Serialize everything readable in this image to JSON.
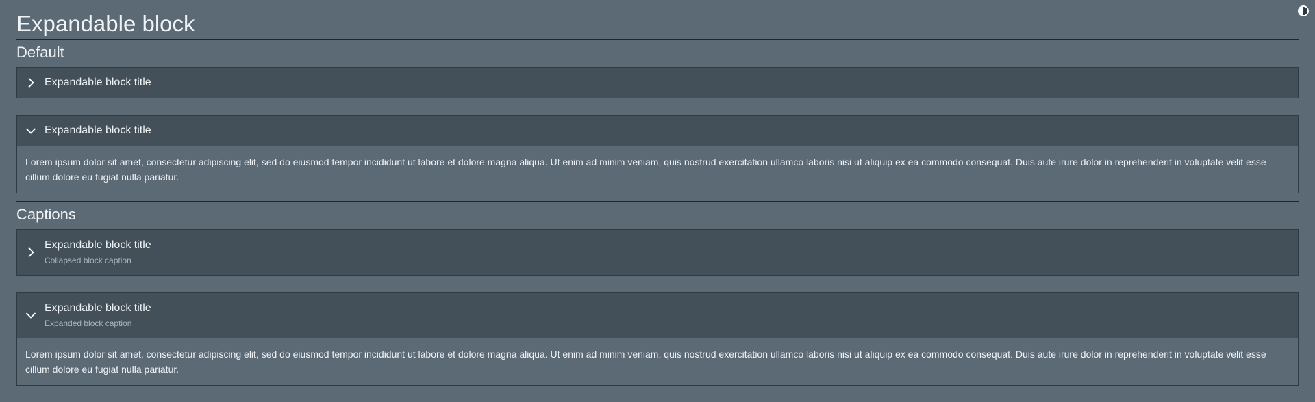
{
  "page": {
    "title": "Expandable block"
  },
  "theme_toggle": {
    "icon": "contrast-icon"
  },
  "sections": {
    "default": {
      "title": "Default",
      "collapsed": {
        "title": "Expandable block title",
        "expanded": false
      },
      "expanded": {
        "title": "Expandable block title",
        "expanded": true,
        "body": "Lorem ipsum dolor sit amet, consectetur adipiscing elit, sed do eiusmod tempor incididunt ut labore et dolore magna aliqua. Ut enim ad minim veniam, quis nostrud exercitation ullamco laboris nisi ut aliquip ex ea commodo consequat. Duis aute irure dolor in reprehenderit in voluptate velit esse cillum dolore eu fugiat nulla pariatur."
      }
    },
    "captions": {
      "title": "Captions",
      "collapsed": {
        "title": "Expandable block title",
        "caption": "Collapsed block caption",
        "expanded": false
      },
      "expanded": {
        "title": "Expandable block title",
        "caption": "Expanded block caption",
        "expanded": true,
        "body": "Lorem ipsum dolor sit amet, consectetur adipiscing elit, sed do eiusmod tempor incididunt ut labore et dolore magna aliqua. Ut enim ad minim veniam, quis nostrud exercitation ullamco laboris nisi ut aliquip ex ea commodo consequat. Duis aute irure dolor in reprehenderit in voluptate velit esse cillum dolore eu fugiat nulla pariatur."
      }
    }
  },
  "colors": {
    "background": "#5c6a76",
    "header": "#43505a",
    "border": "#2f3a42",
    "text": "#eef2f5",
    "caption": "#a9b4bd"
  }
}
